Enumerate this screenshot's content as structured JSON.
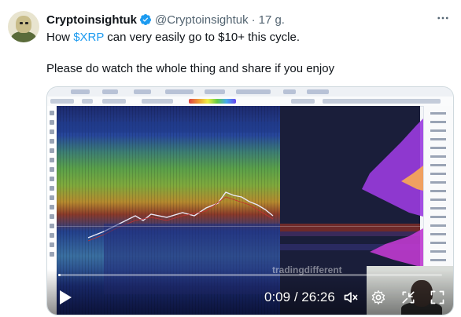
{
  "tweet": {
    "display_name": "Cryptoinsightuk",
    "handle": "@Cryptoinsightuk",
    "separator": "·",
    "time_ago": "17 g.",
    "more_icon": "more-icon",
    "verified_icon": "verified-badge-icon",
    "line1_prefix": "How ",
    "cashtag": "$XRP",
    "line1_suffix": " can very easily go to $10+ this cycle.",
    "line2": "Please do watch the whole thing and share if you enjoy",
    "colors": {
      "link": "#1d9bf0",
      "secondary_text": "#536471",
      "verified": "#1d9bf0"
    }
  },
  "video": {
    "current_time": "0:09",
    "duration": "26:26",
    "time_separator": "/",
    "progress_fraction": 0.006,
    "watermark": "tradingdifferent",
    "icons": {
      "play": "play-icon",
      "mute": "muted-speaker-icon",
      "settings": "settings-gear-icon",
      "pip": "picture-in-picture-icon",
      "fullscreen": "fullscreen-icon"
    }
  }
}
